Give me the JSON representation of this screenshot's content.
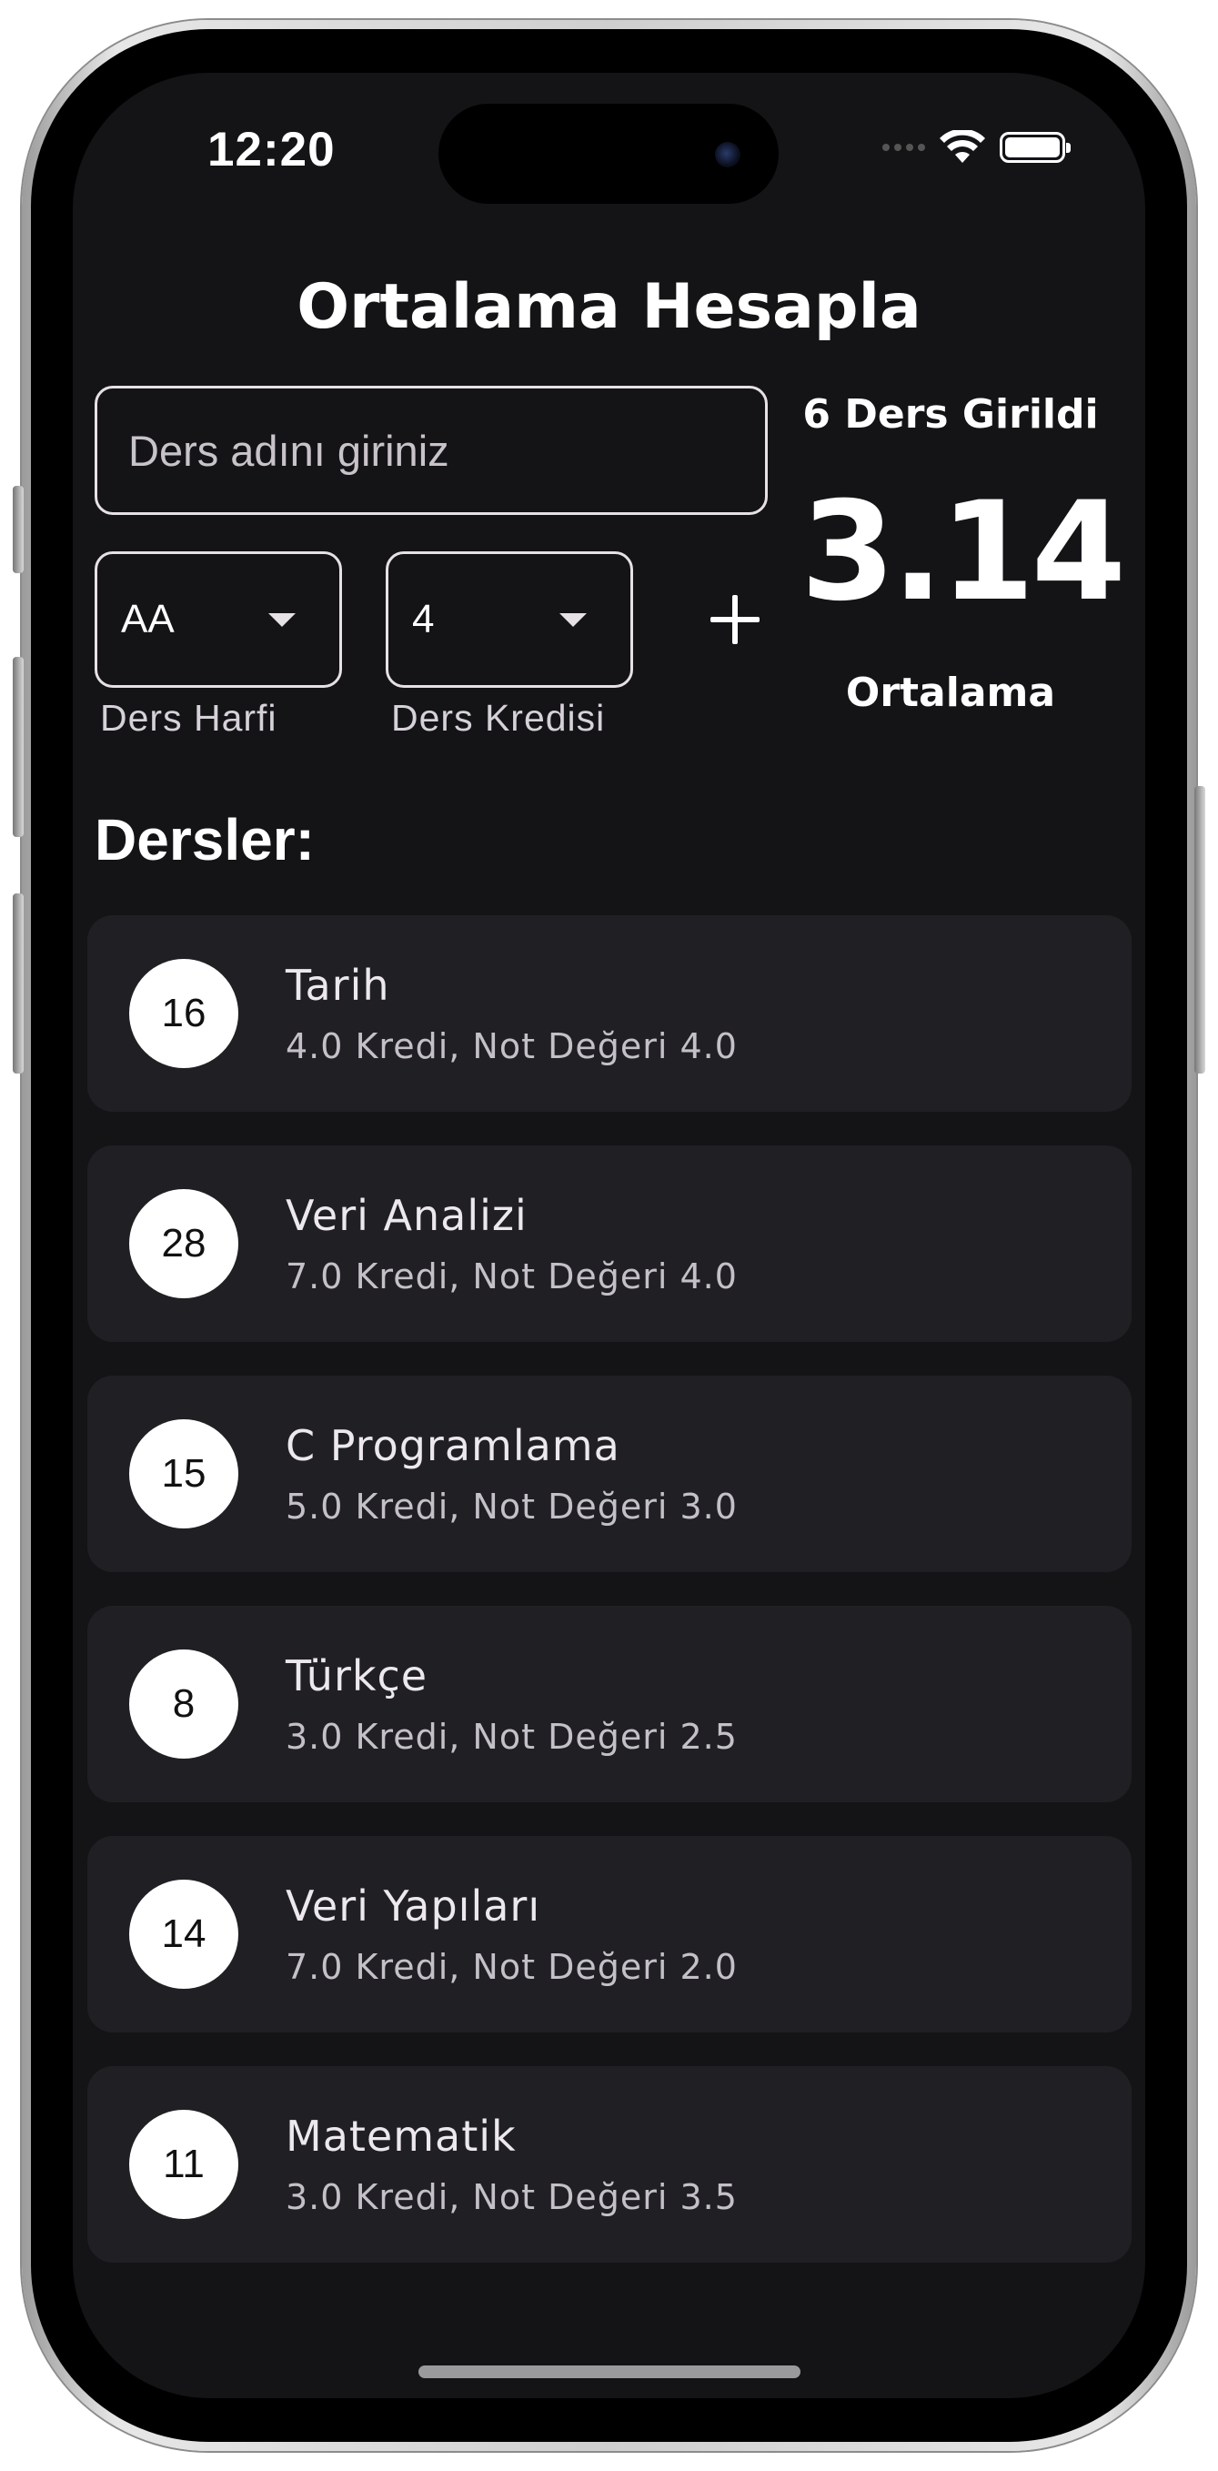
{
  "status_bar": {
    "time": "12:20",
    "icons": [
      "cellular-signal-icon",
      "wifi-icon",
      "battery-icon"
    ]
  },
  "app": {
    "title": "Ortalama Hesapla"
  },
  "form": {
    "course_name_placeholder": "Ders adını giriniz",
    "course_name_value": "",
    "grade_dropdown": {
      "selected": "AA",
      "label": "Ders Harfi"
    },
    "credit_dropdown": {
      "selected": "4",
      "label": "Ders Kredisi"
    },
    "add_button_icon": "plus-icon"
  },
  "summary": {
    "count_text": "6 Ders Girildi",
    "average": "3.14",
    "average_label": "Ortalama"
  },
  "courses_section": {
    "title": "Dersler:",
    "items": [
      {
        "points": "16",
        "name": "Tarih",
        "detail": "4.0 Kredi, Not Değeri 4.0"
      },
      {
        "points": "28",
        "name": "Veri Analizi",
        "detail": "7.0 Kredi, Not Değeri 4.0"
      },
      {
        "points": "15",
        "name": "C Programlama",
        "detail": "5.0 Kredi, Not Değeri 3.0"
      },
      {
        "points": "8",
        "name": "Türkçe",
        "detail": "3.0 Kredi, Not Değeri 2.5"
      },
      {
        "points": "14",
        "name": "Veri Yapıları",
        "detail": "7.0 Kredi, Not Değeri 2.0"
      },
      {
        "points": "11",
        "name": "Matematik",
        "detail": "3.0 Kredi, Not Değeri 3.5"
      }
    ]
  },
  "colors": {
    "background": "#141316",
    "card": "#201f23",
    "text": "#ffffff",
    "border": "#e6e1e5"
  }
}
